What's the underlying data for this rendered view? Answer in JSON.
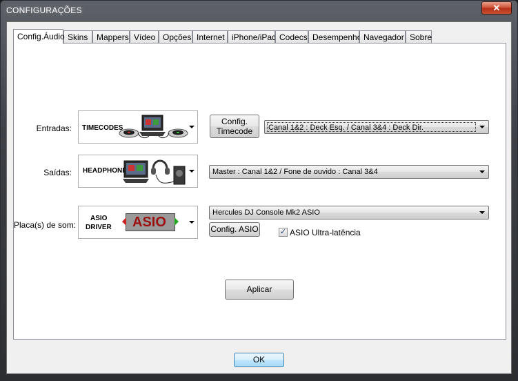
{
  "window": {
    "title": "CONFIGURAÇÕES",
    "close_symbol": "✕"
  },
  "tabs": [
    {
      "label": "Config.Áudio",
      "active": true
    },
    {
      "label": "Skins"
    },
    {
      "label": "Mappers"
    },
    {
      "label": "Vídeo"
    },
    {
      "label": "Opções"
    },
    {
      "label": "Internet"
    },
    {
      "label": "iPhone/iPad"
    },
    {
      "label": "Codecs"
    },
    {
      "label": "Desempenho"
    },
    {
      "label": "Navegador"
    },
    {
      "label": "Sobre"
    }
  ],
  "inputs": {
    "label": "Entradas:",
    "image_caption": "TIMECODES",
    "config_button": "Config.\nTimecode",
    "select_value": "Canal 1&2 : Deck Esq. / Canal 3&4 : Deck Dir."
  },
  "outputs": {
    "label": "Saídas:",
    "image_caption": "HEADPHONES",
    "select_value": "Master : Canal 1&2 / Fone de ouvido : Canal 3&4"
  },
  "soundcard": {
    "label": "Placa(s) de som:",
    "image_caption_1": "ASIO",
    "image_caption_2": "DRIVER",
    "logo_text": "ASIO",
    "select_value": "Hercules DJ Console Mk2 ASIO",
    "config_button": "Config. ASIO",
    "ultra_latency_label": "ASIO Ultra-latência",
    "ultra_latency_checked": true,
    "check_mark": "✓"
  },
  "apply_button": "Aplicar",
  "ok_button": "OK"
}
